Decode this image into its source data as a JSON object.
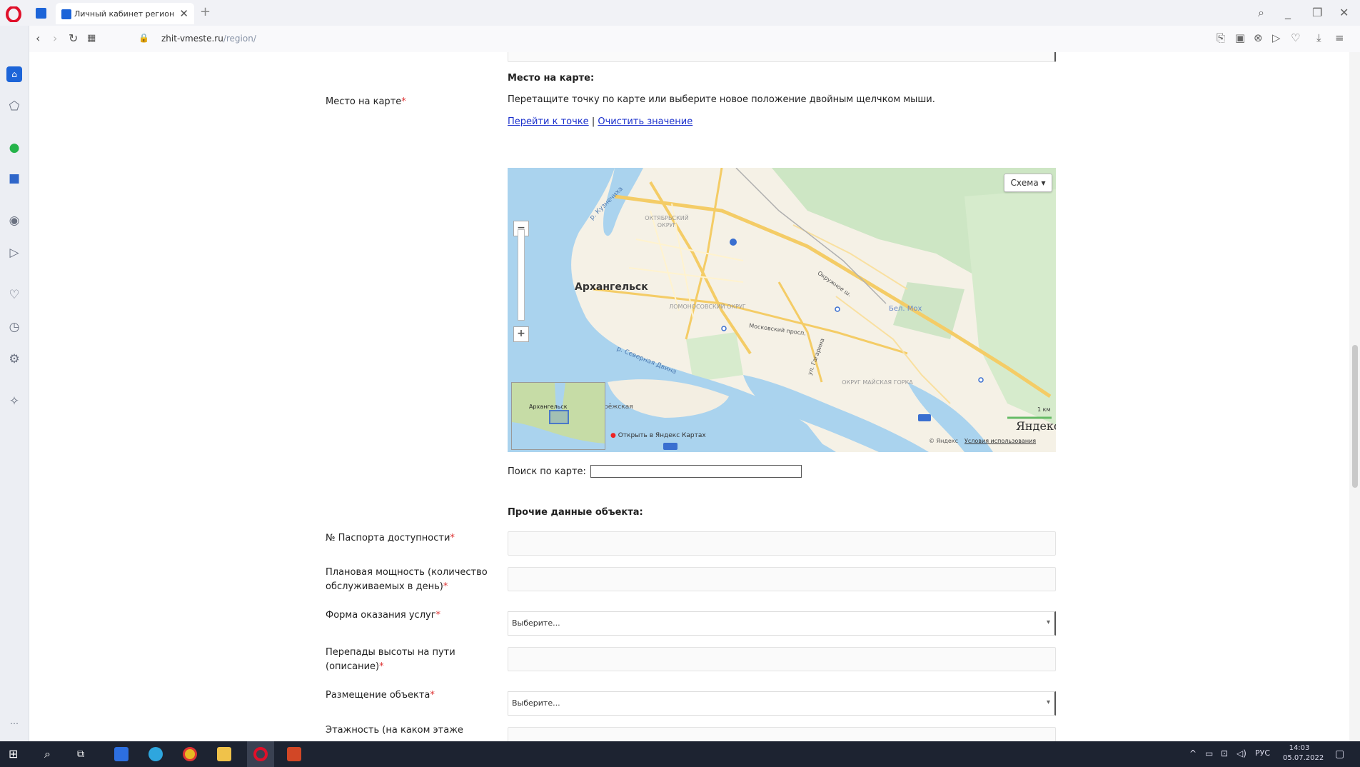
{
  "browser": {
    "tab_title": "Личный кабинет региона",
    "url_host": "zhit-vmeste.ru",
    "url_path": "/region/"
  },
  "form": {
    "map_section_title": "Место на карте:",
    "map_field_label": "Место на карте",
    "map_hint": "Перетащите точку по карте или выберите новое положение двойным щелчком мыши.",
    "link_goto": "Перейти к точке",
    "link_separator": "|",
    "link_clear": "Очистить значение",
    "map_search_label": "Поиск по карте:",
    "map_search_value": "",
    "other_section_title": "Прочие данные объекта:",
    "passport_label": "№ Паспорта доступности",
    "capacity_label_line1": "Плановая мощность (количество",
    "capacity_label_line2": "обслуживаемых в день)",
    "service_form_label": "Форма оказания услуг",
    "service_form_value": "Выберите...",
    "height_label_line1": "Перепады высоты на пути",
    "height_label_line2": "(описание)",
    "placement_label": "Размещение объекта",
    "placement_value": "Выберите...",
    "floors_label_partial": "Этажность (на каком этаже",
    "required_mark": "*"
  },
  "map": {
    "type_button": "Схема ▾",
    "city_label": "Архангельск",
    "district_1": "ОКТЯБРЬСКИЙ ОКРУГ",
    "district_2": "ЛОМОНОСОВСКИЙ ОКРУГ",
    "district_3": "ОКРУГ МАЙСКАЯ ГОРКА",
    "river_label": "р. Северная Двина",
    "river_label_2": "р. Кузнечиха",
    "road_label_1": "Окружное ш.",
    "road_label_2": "Московский просп.",
    "road_label_3": "ул. Гагарина",
    "lake_label": "Бел. Мох",
    "island_label": "рёжская",
    "minimap_label": "Архангельск",
    "open_in_yandex": "Открыть в Яндекс Картах",
    "scale_label": "1 км",
    "brand": "Яндекс",
    "copyright": "© Яндекс",
    "terms_link": "Условия использования"
  },
  "taskbar": {
    "lang": "РУС",
    "time": "14:03",
    "date": "05.07.2022"
  },
  "colors": {
    "required": "#dd3333",
    "link": "#1a2fcc",
    "map_water": "#aad3ee",
    "map_land": "#f5f1e6",
    "map_forest": "#cde6c4",
    "taskbar": "#1d2331"
  }
}
